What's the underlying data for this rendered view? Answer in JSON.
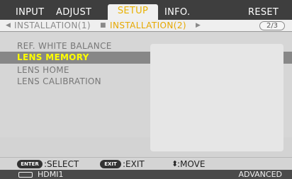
{
  "tabs": [
    {
      "label": "INPUT"
    },
    {
      "label": "ADJUST"
    },
    {
      "label": "SETUP"
    },
    {
      "label": "INFO."
    },
    {
      "label": "RESET"
    }
  ],
  "subtabs": {
    "items": [
      {
        "label": "INSTALLATION(1)"
      },
      {
        "label": "INSTALLATION(2)"
      }
    ],
    "page": "2/3"
  },
  "menu": {
    "items": [
      {
        "label": "REF. WHITE BALANCE"
      },
      {
        "label": "LENS MEMORY"
      },
      {
        "label": "LENS HOME"
      },
      {
        "label": "LENS CALIBRATION"
      }
    ],
    "selected_index": 1
  },
  "footer": {
    "enter_key": "ENTER",
    "enter_action": ":SELECT",
    "exit_key": "EXIT",
    "exit_action": ":EXIT",
    "move_action": ":MOVE"
  },
  "status": {
    "source": "HDMI1",
    "mode": "ADVANCED"
  },
  "colors": {
    "active_tab_text": "#e9b200",
    "selected_item_text": "#ffff00",
    "selected_item_bg": "#878787"
  }
}
